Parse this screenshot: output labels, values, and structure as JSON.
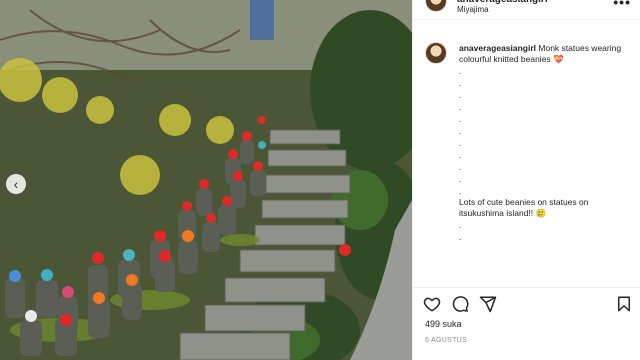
{
  "post": {
    "username": "anaverageasiangirl",
    "location": "Miyajima",
    "more_label": "•••"
  },
  "caption": {
    "username": "anaverageasiangirl",
    "text_line1": "Monk statues wearing colourful knitted beanies 💝",
    "dots_before": [
      ".",
      ".",
      ".",
      ".",
      ".",
      ".",
      ".",
      ".",
      ".",
      ".",
      "."
    ],
    "text_line2": "Lots of cute beanies on statues on itsukushima island!! 🥲",
    "dots_after": [
      ".",
      "."
    ]
  },
  "photo": {
    "description_icon": "carousel-prev-icon",
    "prev_glyph": "‹"
  },
  "actions": {
    "icons": [
      "heart-icon",
      "comment-icon",
      "share-icon",
      "bookmark-icon"
    ],
    "likes": "499 suka",
    "date": "6 AGUSTUS"
  },
  "colors": {
    "text": "#262626",
    "muted": "#8e8e8e",
    "border": "#efefef"
  }
}
